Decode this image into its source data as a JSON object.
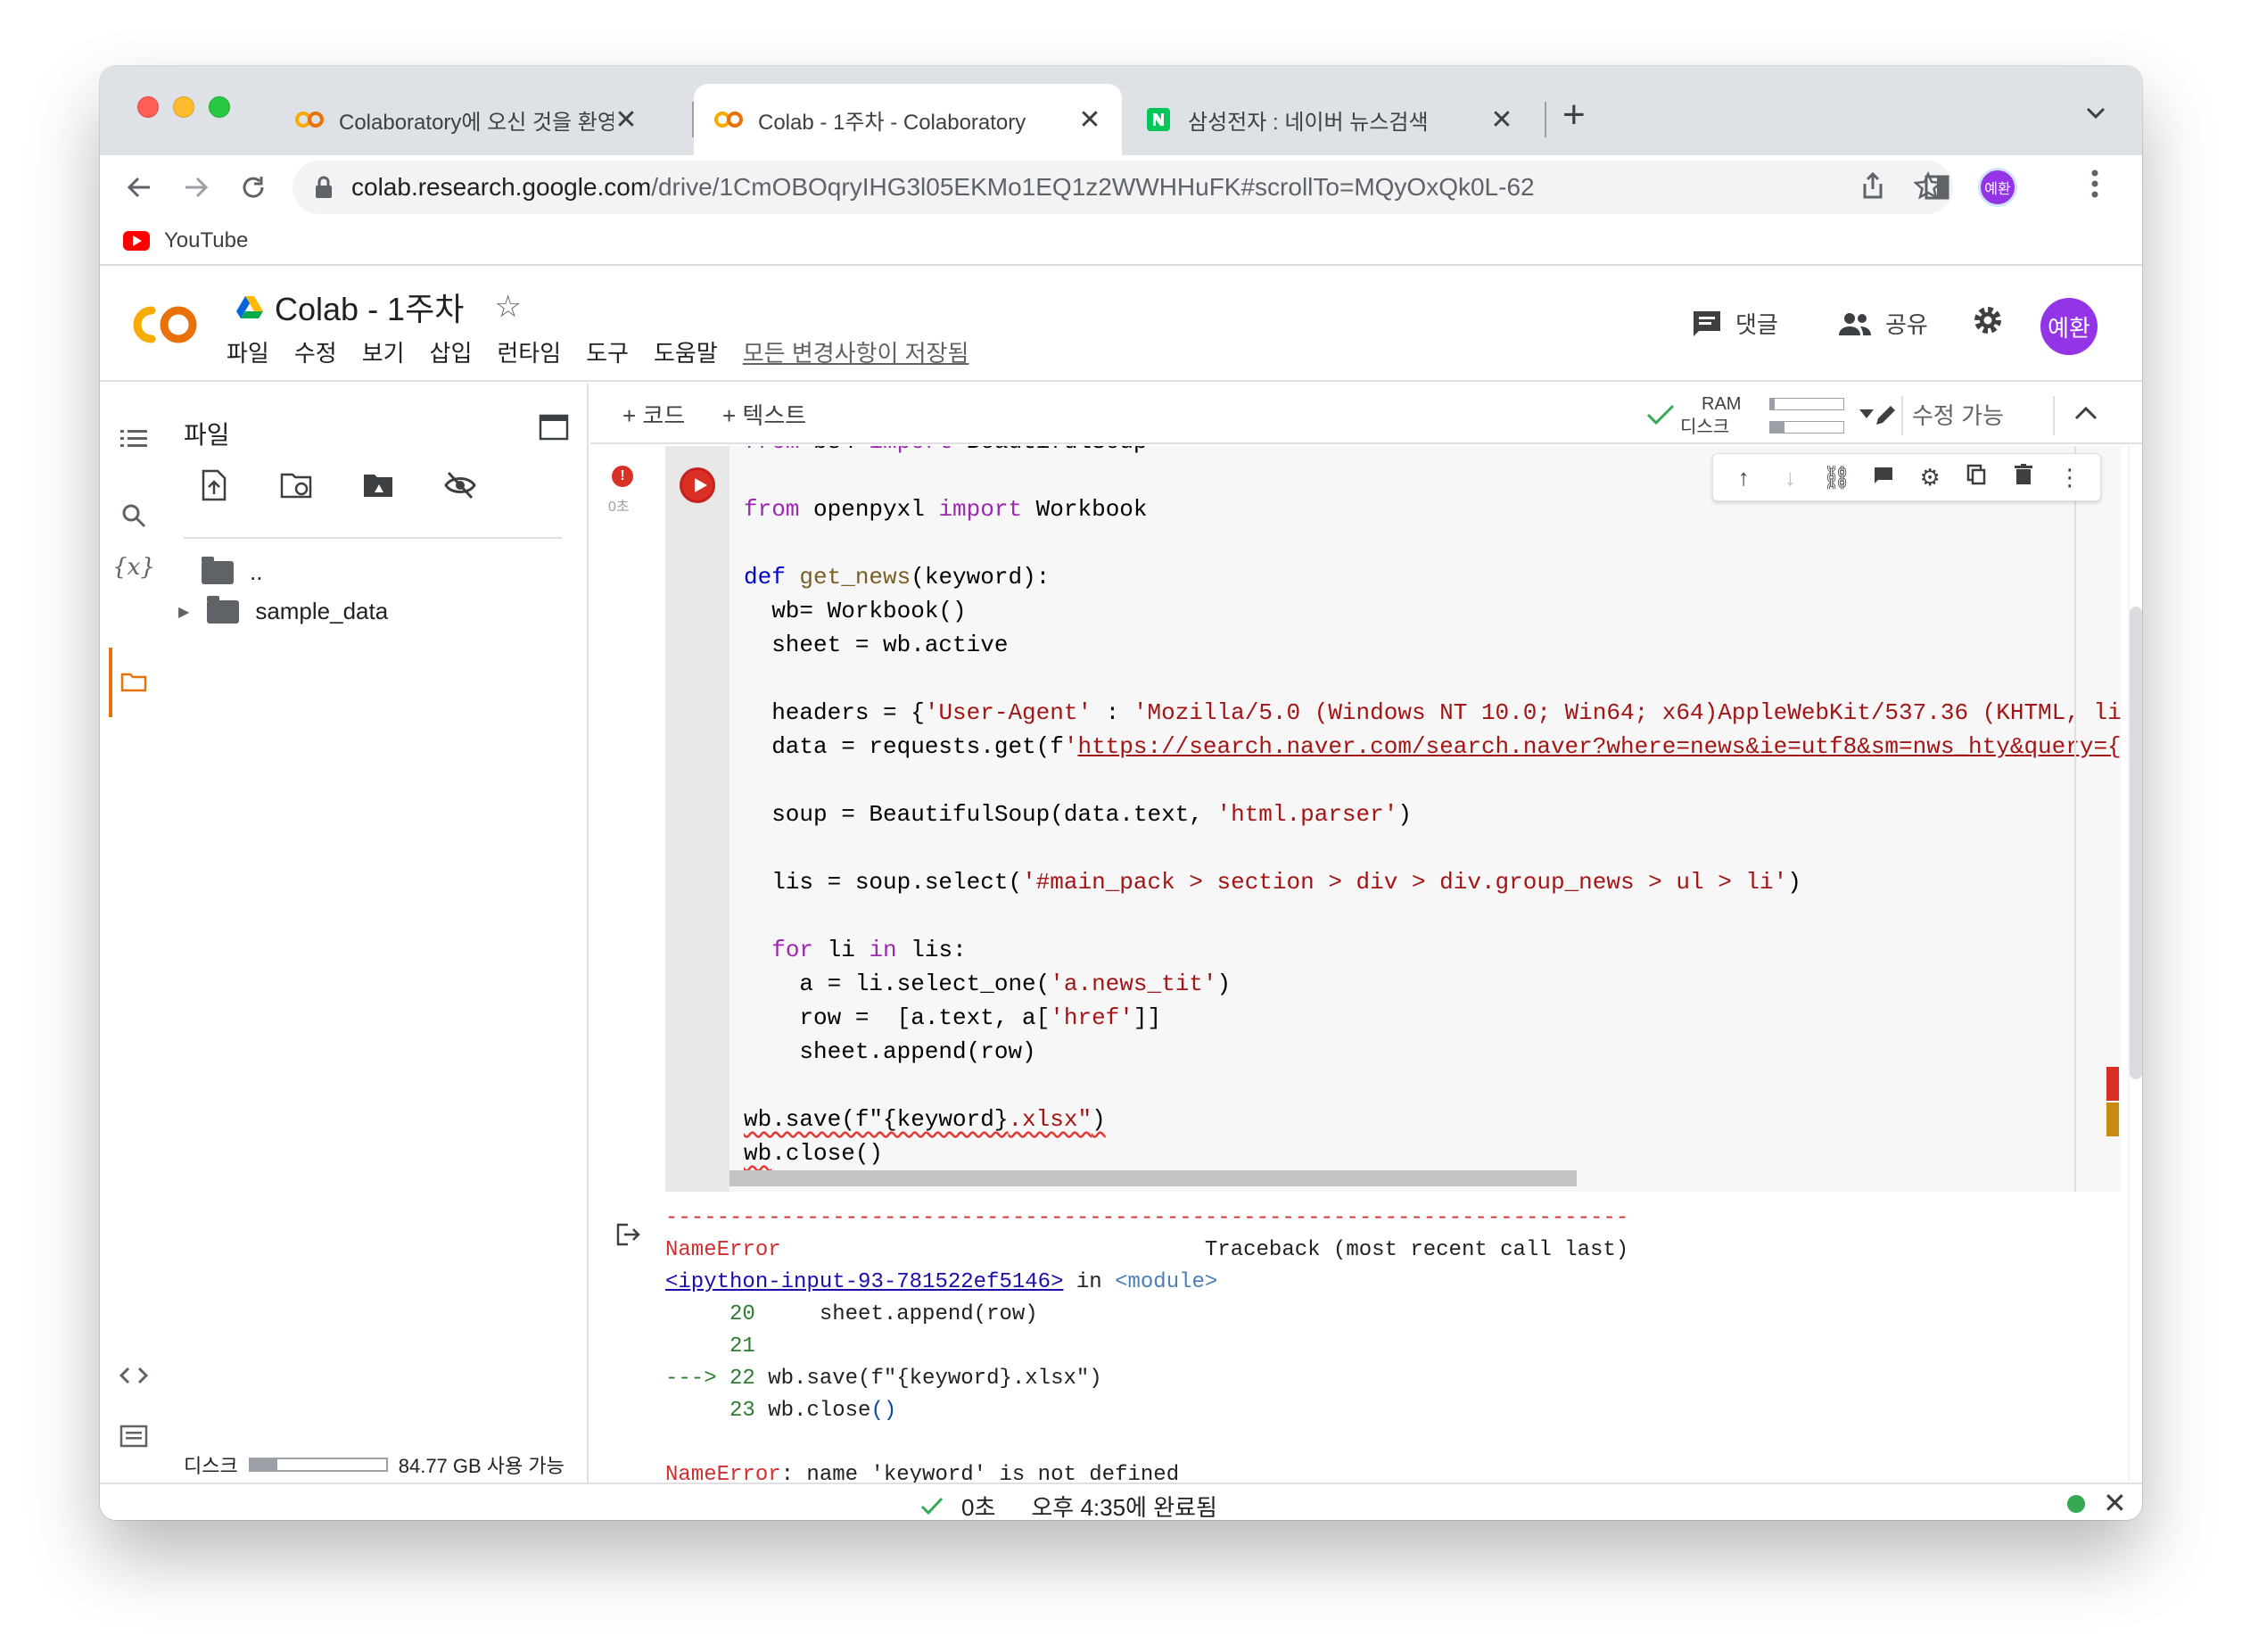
{
  "browser": {
    "tabs": [
      {
        "title": "Colaboratory에 오신 것을 환영합니",
        "active": false
      },
      {
        "title": "Colab - 1주차 - Colaboratory",
        "active": true
      },
      {
        "title": "삼성전자 : 네이버 뉴스검색",
        "active": false
      }
    ],
    "close_glyph": "✕",
    "new_tab_glyph": "+",
    "url_host": "colab.research.google.com",
    "url_path": "/drive/1CmOBOqryIHG3l05EKMo1EQ1z2WWHHuFK#scrollTo=MQyOxQk0L-62",
    "profile_initials": "예환",
    "bookmark": "YouTube"
  },
  "colab": {
    "doc_title": "Colab - 1주차",
    "menus": [
      "파일",
      "수정",
      "보기",
      "삽입",
      "런타임",
      "도구",
      "도움말"
    ],
    "saved_status": "모든 변경사항이 저장됨",
    "comment_label": "댓글",
    "share_label": "공유",
    "avatar_initials": "예환"
  },
  "files_panel": {
    "title": "파일",
    "tree": [
      "..",
      "sample_data"
    ],
    "disk_label": "디스크",
    "disk_free": "84.77 GB 사용 가능",
    "disk_used_fraction": 0.2
  },
  "notebook": {
    "add_code": "+ 코드",
    "add_text": "+ 텍스트",
    "ram_label": "RAM",
    "disk_label": "디스크",
    "ram_used_fraction": 0.06,
    "disk_used_fraction": 0.2,
    "edit_mode": "수정 가능",
    "exec_time": "0초"
  },
  "status_bar": {
    "duration": "0초",
    "completed": "오후 4:35에 완료됨"
  },
  "icons": {
    "back": "arrow-left-icon",
    "forward": "arrow-right-icon",
    "reload": "reload-icon",
    "share": "share-icon",
    "bookmark_star": "star-icon",
    "side_panel": "side-panel-icon",
    "menu": "kebab-icon"
  }
}
